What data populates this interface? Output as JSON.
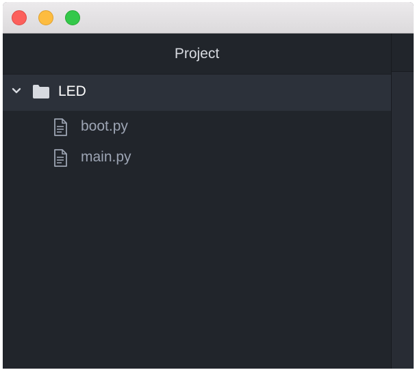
{
  "window": {
    "controls": [
      "close",
      "minimize",
      "zoom"
    ],
    "colors": {
      "close": "#fc605c",
      "minimize": "#fdbc40",
      "zoom": "#34c84a"
    }
  },
  "tree_view": {
    "header": {
      "title": "Project"
    },
    "root": {
      "label": "LED",
      "expanded": true,
      "icon": "folder-icon",
      "chevron_icon": "chevron-down-icon"
    },
    "files": [
      {
        "label": "boot.py",
        "icon": "file-text-icon"
      },
      {
        "label": "main.py",
        "icon": "file-text-icon"
      }
    ]
  },
  "theme": {
    "sidebar_bg": "#21252b",
    "selected_row_bg": "#2c313a",
    "text_primary": "#ffffff",
    "text_muted": "#9da5b4"
  }
}
